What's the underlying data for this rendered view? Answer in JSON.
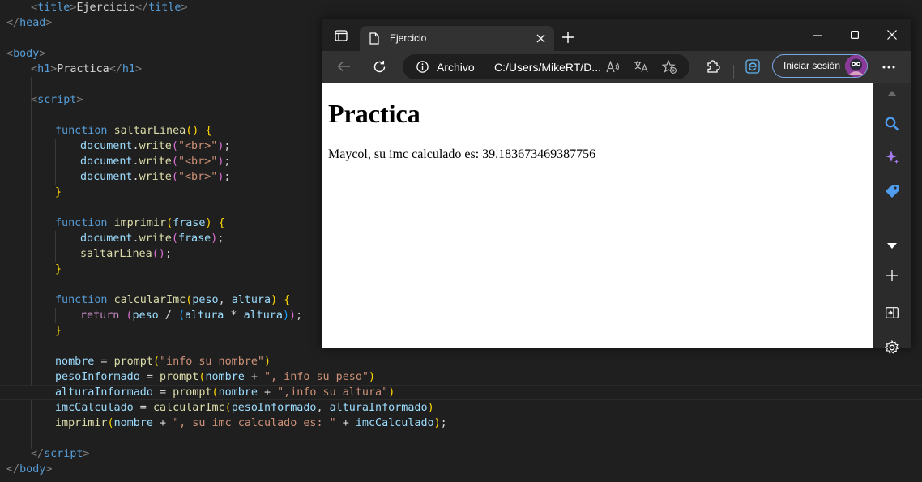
{
  "editor": {
    "title_tag": "title",
    "title_text": "Ejercicio",
    "head_tag": "head",
    "body_tag": "body",
    "h1_tag": "h1",
    "h1_text": "Practica",
    "script_tag": "script",
    "fn1": {
      "keyword": "function",
      "name": "saltarLinea",
      "call": "document",
      "method": "write",
      "arg": "\"<br>\""
    },
    "fn2": {
      "keyword": "function",
      "name": "imprimir",
      "param": "frase",
      "call": "document",
      "method": "write",
      "inner_call": "saltarLinea"
    },
    "fn3": {
      "keyword": "function",
      "name": "calcularImc",
      "param1": "peso",
      "param2": "altura",
      "return_kw": "return"
    },
    "stmt1": {
      "var": "nombre",
      "fn": "prompt",
      "str": "\"info su nombre\""
    },
    "stmt2": {
      "var": "pesoInformado",
      "fn": "prompt",
      "arg": "nombre",
      "str": "\", info su peso\""
    },
    "stmt3": {
      "var": "alturaInformado",
      "fn": "prompt",
      "arg": "nombre",
      "str": "\",info su altura\""
    },
    "stmt4": {
      "var": "imcCalculado",
      "fn": "calcularImc",
      "arg1": "pesoInformado",
      "arg2": "alturaInformado"
    },
    "stmt5": {
      "fn": "imprimir",
      "arg": "nombre",
      "str": "\", su imc calculado es: \"",
      "arg2": "imcCalculado"
    }
  },
  "browser": {
    "tab_title": "Ejercicio",
    "address_scheme_label": "Archivo",
    "address_url": "C:/Users/MikeRT/D...",
    "signin_label": "Iniciar sesión",
    "icons": [
      "sidebar-toggle-icon",
      "page-icon",
      "close-icon",
      "new-tab-icon",
      "minimize-icon",
      "maximize-icon",
      "window-close-icon",
      "back-icon",
      "refresh-icon",
      "info-icon",
      "read-aloud-icon",
      "translate-icon",
      "favorite-add-icon",
      "extensions-icon",
      "browser-essentials-icon",
      "more-icon",
      "search-icon",
      "copilot-icon",
      "shopping-tag-icon",
      "chevron-down-icon",
      "add-icon",
      "split-screen-icon",
      "settings-icon"
    ]
  },
  "page": {
    "heading": "Practica",
    "output": "Maycol, su imc calculado es: 39.183673469387756"
  }
}
